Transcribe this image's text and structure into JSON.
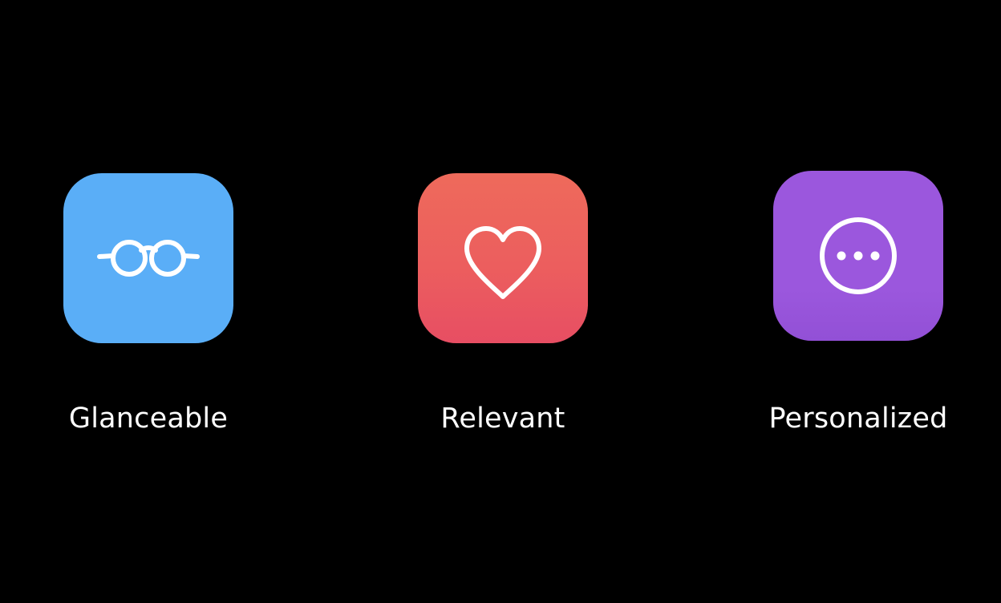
{
  "features": [
    {
      "label": "Glanceable",
      "icon": "glasses-icon",
      "color_top": "#5aaef7",
      "color_bottom": "#5aaef7"
    },
    {
      "label": "Relevant",
      "icon": "heart-icon",
      "color_top": "#ee6a5b",
      "color_bottom": "#e74e63"
    },
    {
      "label": "Personalized",
      "icon": "ellipsis-circle-icon",
      "color_top": "#9b57dd",
      "color_bottom": "#9250d6"
    }
  ]
}
